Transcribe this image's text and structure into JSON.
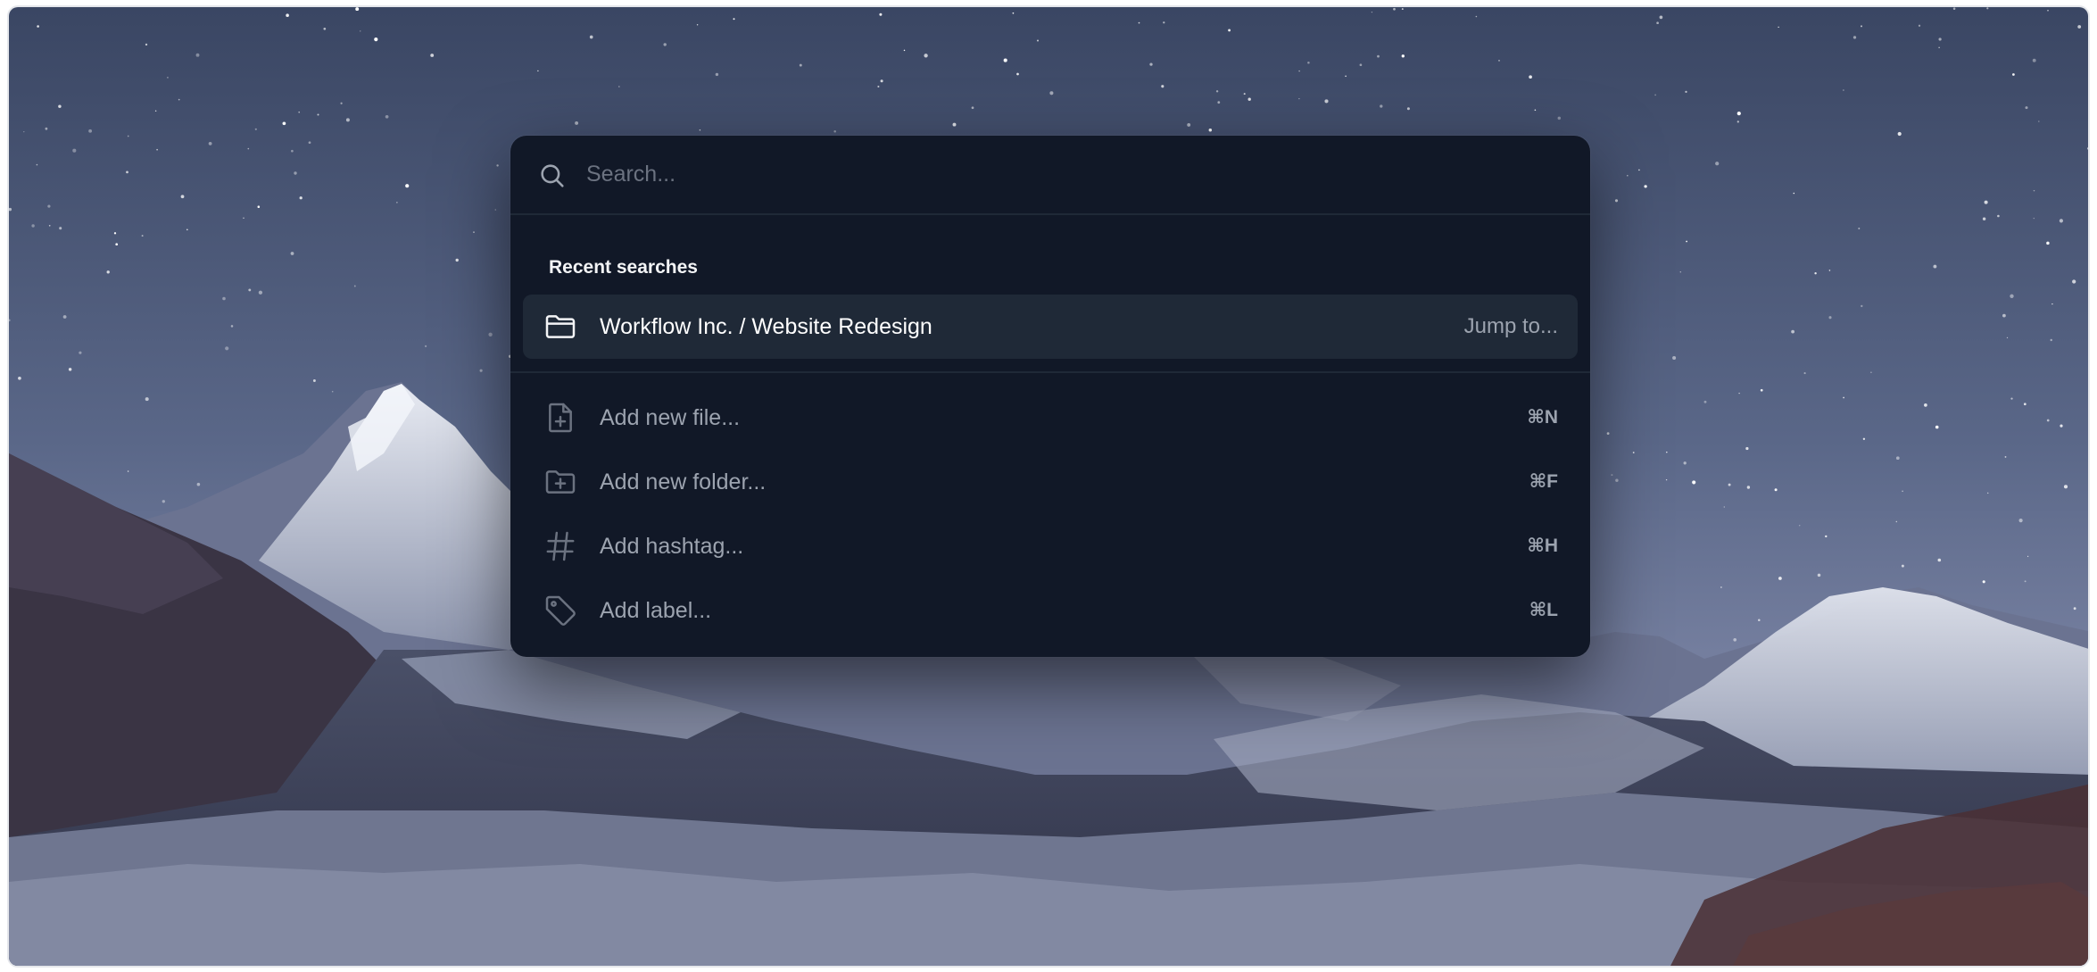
{
  "search": {
    "placeholder": "Search...",
    "value": ""
  },
  "recent": {
    "title": "Recent searches",
    "items": [
      {
        "label": "Workflow Inc. / Website Redesign",
        "hint": "Jump to...",
        "icon": "folder-icon"
      }
    ]
  },
  "actions": [
    {
      "label": "Add new file...",
      "shortcut": "⌘N",
      "icon": "file-plus-icon"
    },
    {
      "label": "Add new folder...",
      "shortcut": "⌘F",
      "icon": "folder-plus-icon"
    },
    {
      "label": "Add hashtag...",
      "shortcut": "⌘H",
      "icon": "hashtag-icon"
    },
    {
      "label": "Add label...",
      "shortcut": "⌘L",
      "icon": "tag-icon"
    }
  ],
  "colors": {
    "panel": "#111827",
    "active_row": "#1f2937",
    "muted_text": "#9ca3af",
    "placeholder": "#6b7280"
  }
}
